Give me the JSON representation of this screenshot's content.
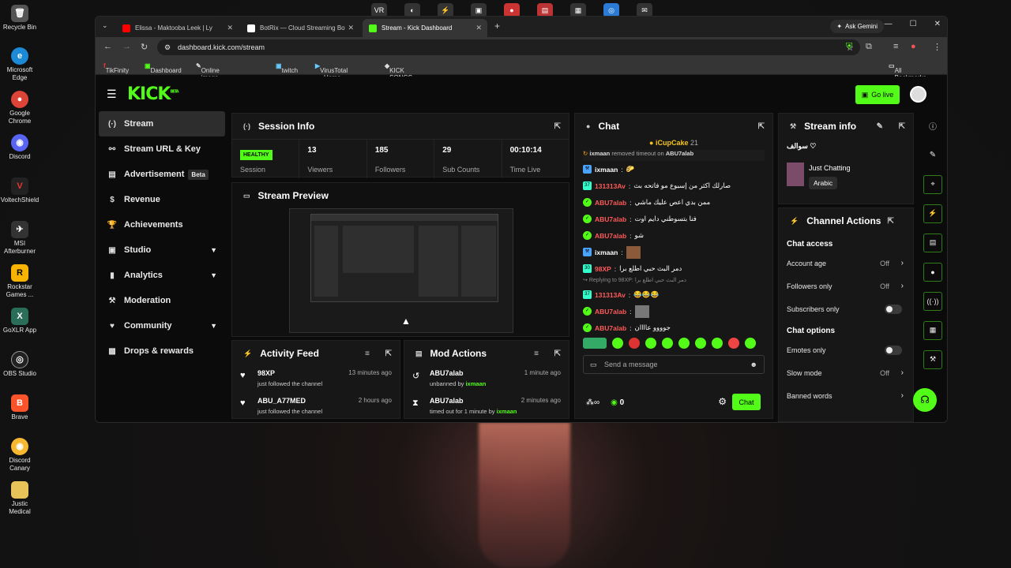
{
  "desktop": {
    "icons": [
      "Recycle Bin",
      "Microsoft Edge",
      "Google Chrome",
      "Discord",
      "VoltechShield",
      "MSI Afterburner",
      "Rockstar Games ...",
      "GoXLR App",
      "OBS Studio",
      "Brave",
      "Discord Canary",
      "Justic Medical"
    ]
  },
  "browser": {
    "tabs": [
      {
        "label": "Elissa - Maktooba Leek | Ly",
        "color": "#ff0000"
      },
      {
        "label": "BotRix — Cloud Streaming Bot",
        "color": "#ffffff"
      },
      {
        "label": "Stream - Kick Dashboard",
        "color": "#53fc18"
      }
    ],
    "ask_gemini": "Ask Gemini",
    "url": "dashboard.kick.com/stream",
    "bookmarks": [
      "TikFinity",
      "Dashboard",
      "Online image resize...",
      "twitch",
      "VirusTotal - Home",
      "KICK SONGS"
    ],
    "all_bookmarks": "All Bookmarks"
  },
  "header": {
    "logo": "KICK",
    "logo_sup": "BETA",
    "go_live": "Go live"
  },
  "sidebar": {
    "items": [
      {
        "label": "Stream",
        "icon": "(·)"
      },
      {
        "label": "Stream URL & Key",
        "icon": "⚯"
      },
      {
        "label": "Advertisement",
        "icon": "▤",
        "badge": "Beta"
      },
      {
        "label": "Revenue",
        "icon": "$"
      },
      {
        "label": "Achievements",
        "icon": "🏆"
      },
      {
        "label": "Studio",
        "icon": "▣"
      },
      {
        "label": "Analytics",
        "icon": "▮"
      },
      {
        "label": "Moderation",
        "icon": "⚒"
      },
      {
        "label": "Community",
        "icon": "♥"
      },
      {
        "label": "Drops & rewards",
        "icon": "▩"
      }
    ]
  },
  "session": {
    "title": "Session Info",
    "health": "HEALTHY",
    "stats": [
      {
        "label": "Session",
        "value": ""
      },
      {
        "label": "Viewers",
        "value": "13"
      },
      {
        "label": "Followers",
        "value": "185"
      },
      {
        "label": "Sub Counts",
        "value": "29"
      },
      {
        "label": "Time Live",
        "value": "00:10:14"
      }
    ]
  },
  "preview": {
    "title": "Stream Preview"
  },
  "activity": {
    "title": "Activity Feed",
    "items": [
      {
        "name": "98XP",
        "text": "just followed the channel",
        "time": "13 minutes ago"
      },
      {
        "name": "ABU_A77MED",
        "text": "just followed the channel",
        "time": "2 hours ago"
      }
    ]
  },
  "mod": {
    "title": "Mod Actions",
    "items": [
      {
        "name": "ABU7alab",
        "text": "unbanned by",
        "by": "ixmaan",
        "time": "1 minute ago"
      },
      {
        "name": "ABU7alab",
        "text": "timed out for 1 minute by",
        "by": "ixmaan",
        "time": "2 minutes ago"
      }
    ]
  },
  "chat": {
    "title": "Chat",
    "top_user": "iCupCake",
    "top_count": "21",
    "system_by": "ixmaan",
    "system_text": "removed timeout on",
    "system_target": "ABU7alab",
    "messages": [
      {
        "user": "ixmaan",
        "color": "#ffffff",
        "text": "🌮"
      },
      {
        "user": "131313Av",
        "color": "#ff5a5a",
        "text": "صارلك اكثر من إسبوع مو فاتحه بث"
      },
      {
        "user": "ABU7alab",
        "color": "#ff5a5a",
        "text": "ممن بدي اعص عليك ماشي"
      },
      {
        "user": "ABU7alab",
        "color": "#ff5a5a",
        "text": "فنا بتسوطني دايم اوت"
      },
      {
        "user": "ABU7alab",
        "color": "#ff5a5a",
        "text": "شو"
      },
      {
        "user": "ixmaan",
        "color": "#ffffff",
        "text": "▣"
      },
      {
        "user": "98XP",
        "color": "#ff5a5a",
        "text": "دمر البث حبي اطلع برا"
      },
      {
        "user": "131313Av",
        "color": "#ff5a5a",
        "text": "😂😂😂"
      },
      {
        "user": "ABU7alab",
        "color": "#ff5a5a",
        "text": "▣"
      },
      {
        "user": "ABU7alab",
        "color": "#ff5a5a",
        "text": "جوووو عاااان"
      }
    ],
    "reply": "Replying to 98XP: دمر البث حبي اطلع برا",
    "placeholder": "Send a message",
    "count": "0",
    "send": "Chat"
  },
  "stream_info": {
    "title": "Stream info",
    "name": "سوالف ♡",
    "category": "Just Chatting",
    "language": "Arabic"
  },
  "channel_actions": {
    "title": "Channel Actions",
    "chat_access": "Chat access",
    "rows1": [
      {
        "label": "Account age",
        "value": "Off"
      },
      {
        "label": "Followers only",
        "value": "Off"
      },
      {
        "label": "Subscribers only",
        "value": ""
      }
    ],
    "chat_options": "Chat options",
    "rows2": [
      {
        "label": "Emotes only",
        "value": ""
      },
      {
        "label": "Slow mode",
        "value": "Off"
      },
      {
        "label": "Banned words",
        "value": ""
      }
    ]
  },
  "colors": {
    "accent": "#53fc18",
    "bg": "#0b0b0b",
    "panel": "#171717"
  }
}
